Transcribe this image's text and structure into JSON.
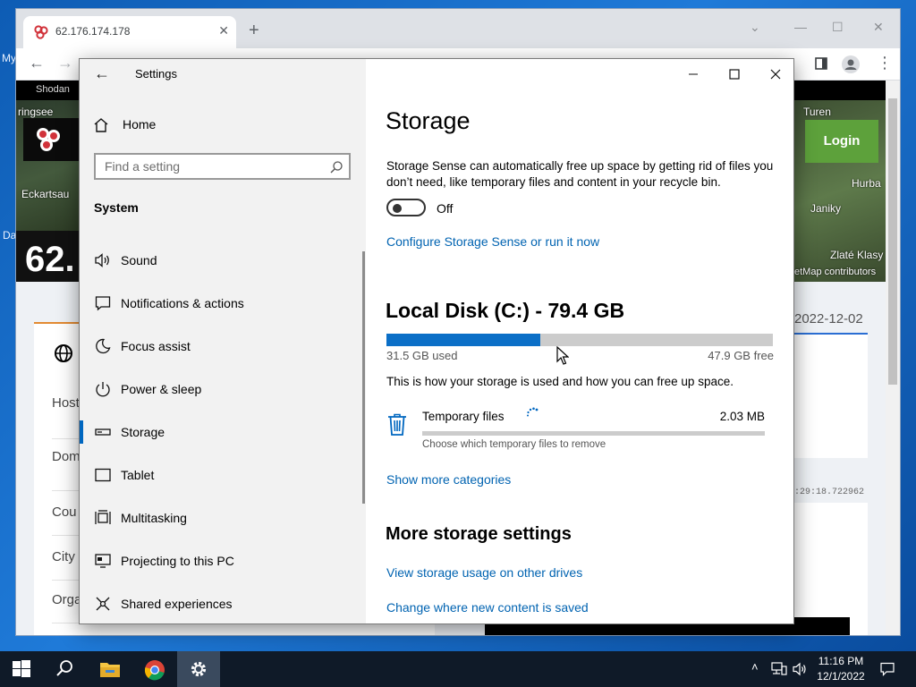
{
  "browser": {
    "tab_title": "62.176.174.178",
    "page": {
      "nav_link": "Shodan",
      "map_labels_left": [
        "ringsee",
        "Eckartsau"
      ],
      "map_labels_right": [
        "Turen",
        "Hurba",
        "Janiky",
        "Zlaté Klasy",
        "etMap contributors"
      ],
      "ip_partial": "62.",
      "login_label": "Login",
      "info_rows": [
        "Host",
        "Dom",
        "Cou",
        "City",
        "Orga"
      ],
      "date": "2022-12-02",
      "timestamp": ":29:18.722962"
    }
  },
  "desktop": {
    "edge_labels": [
      "My",
      "Da"
    ]
  },
  "settings": {
    "window_title": "Settings",
    "home_label": "Home",
    "search_placeholder": "Find a setting",
    "section_label": "System",
    "nav_items": [
      {
        "label": "Sound",
        "icon": "speaker-icon"
      },
      {
        "label": "Notifications & actions",
        "icon": "notification-icon"
      },
      {
        "label": "Focus assist",
        "icon": "moon-icon"
      },
      {
        "label": "Power & sleep",
        "icon": "power-icon"
      },
      {
        "label": "Storage",
        "icon": "storage-icon",
        "selected": true
      },
      {
        "label": "Tablet",
        "icon": "tablet-icon"
      },
      {
        "label": "Multitasking",
        "icon": "multitasking-icon"
      },
      {
        "label": "Projecting to this PC",
        "icon": "projecting-icon"
      },
      {
        "label": "Shared experiences",
        "icon": "shared-icon"
      }
    ],
    "content": {
      "title": "Storage",
      "description": "Storage Sense can automatically free up space by getting rid of files you don’t need, like temporary files and content in your recycle bin.",
      "toggle_state": "Off",
      "configure_link": "Configure Storage Sense or run it now",
      "disk_title": "Local Disk (C:) - 79.4 GB",
      "used_label": "31.5 GB used",
      "free_label": "47.9 GB free",
      "used_fraction": 0.397,
      "usage_desc": "This is how your storage is used and how you can free up space.",
      "category": {
        "name": "Temporary files",
        "size": "2.03 MB",
        "fraction": 0.0,
        "subtitle": "Choose which temporary files to remove"
      },
      "show_more_link": "Show more categories",
      "more_settings_heading": "More storage settings",
      "other_drives_link": "View storage usage on other drives",
      "new_content_link": "Change where new content is saved"
    }
  },
  "taskbar": {
    "time": "11:16 PM",
    "date": "12/1/2022"
  },
  "colors": {
    "accent": "#0067c0",
    "link": "#0063b1",
    "bar": "#0b6fc7",
    "login": "#5da13b"
  }
}
